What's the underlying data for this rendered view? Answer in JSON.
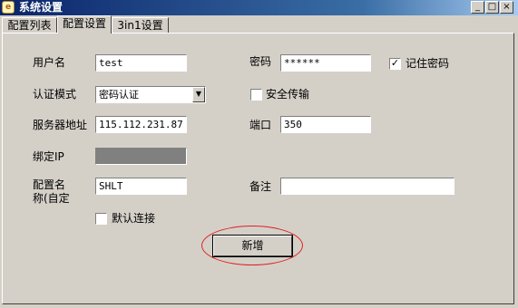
{
  "window": {
    "title": "系统设置",
    "controls": {
      "minimize": "_",
      "maximize": "□",
      "close": "×"
    }
  },
  "tabs": [
    {
      "label": "配置列表",
      "active": false
    },
    {
      "label": "配置设置",
      "active": true
    },
    {
      "label": "3in1设置",
      "active": false
    }
  ],
  "form": {
    "username": {
      "label": "用户名",
      "value": "test"
    },
    "password": {
      "label": "密码",
      "value": "******"
    },
    "remember_password": {
      "label": "记住密码",
      "checked": true,
      "mark": "✓"
    },
    "auth_mode": {
      "label": "认证模式",
      "value": "密码认证"
    },
    "secure_transfer": {
      "label": "安全传输",
      "checked": false
    },
    "server_address": {
      "label": "服务器地址",
      "value": "115.112.231.87"
    },
    "port": {
      "label": "端口",
      "value": "350"
    },
    "bind_ip": {
      "label": "绑定IP",
      "value": ""
    },
    "config_name": {
      "label": "配置名\n称(自定",
      "value": "SHLT"
    },
    "remark": {
      "label": "备注",
      "value": ""
    },
    "default_connect": {
      "label": "默认连接",
      "checked": false
    }
  },
  "buttons": {
    "add": "新增"
  },
  "colors": {
    "highlight_ellipse": "#e02020",
    "titlebar_start": "#0a246a",
    "titlebar_end": "#a6caf0"
  }
}
